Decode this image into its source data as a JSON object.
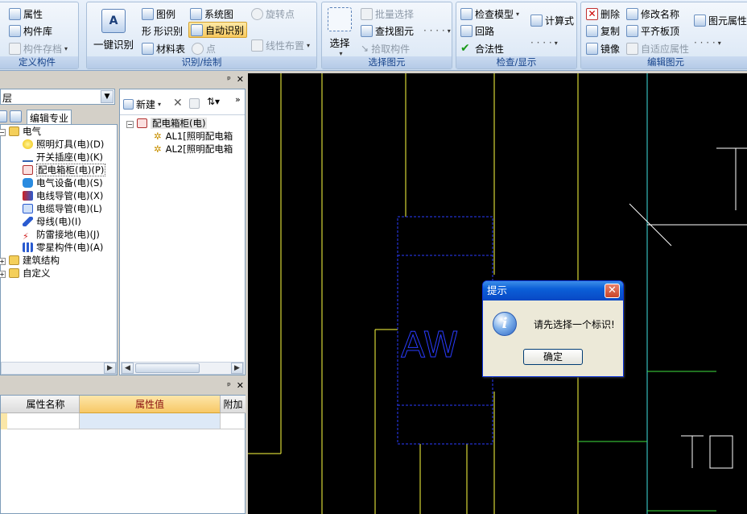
{
  "ribbon": {
    "groups": {
      "define": {
        "title": "定义构件",
        "items": [
          "属性",
          "构件库",
          "构件存档"
        ]
      },
      "identify": {
        "title": "识别/绘制",
        "big": "一键识别",
        "big_icon": "A",
        "items": [
          "图例",
          "系统图",
          "旋转点",
          "形识别",
          "自动识别",
          "材料表",
          "点",
          "线性布置"
        ],
        "shape_icon": "形"
      },
      "select": {
        "title": "选择图元",
        "big": "选择",
        "items": [
          "批量选择",
          "查找图元",
          "拾取构件"
        ],
        "more": "· · · ·"
      },
      "check": {
        "title": "检查/显示",
        "items": [
          "检查模型",
          "计算式",
          "回路",
          "合法性"
        ],
        "more": "· · · ·"
      },
      "edit": {
        "title": "编辑图元",
        "items": [
          "删除",
          "修改名称",
          "图元属性",
          "复制",
          "平齐板顶",
          "镜像",
          "自适应属性"
        ],
        "more": "· · · ·"
      }
    }
  },
  "left": {
    "dropdown_value": "层",
    "tab": "编辑专业",
    "tree": {
      "root": "电气",
      "children": [
        "照明灯具(电)(D)",
        "开关插座(电)(K)",
        "配电箱柜(电)(P)",
        "电气设备(电)(S)",
        "电线导管(电)(X)",
        "电缆导管(电)(L)",
        "母线(电)(I)",
        "防雷接地(电)(J)",
        "零星构件(电)(A)"
      ],
      "others": [
        "建筑结构",
        "自定义"
      ]
    }
  },
  "middle": {
    "new_button": "新建",
    "tree_root": "配电箱柜(电)",
    "items": [
      "AL1[照明配电箱",
      "AL2[照明配电箱"
    ]
  },
  "properties": {
    "headers": [
      "属性名称",
      "属性值",
      "附加"
    ]
  },
  "canvas": {
    "texts": [
      "AW",
      "T",
      "TO"
    ]
  },
  "dialog": {
    "title": "提示",
    "message": "请先选择一个标识!",
    "ok": "确定",
    "close": "✕"
  },
  "colors": {
    "canvas_bg": "#000000",
    "line_yellow": "#ffff40",
    "line_cyan": "#40e0e0",
    "line_green": "#40e040",
    "line_blue": "#2a3cff",
    "line_white": "#ffffff"
  }
}
